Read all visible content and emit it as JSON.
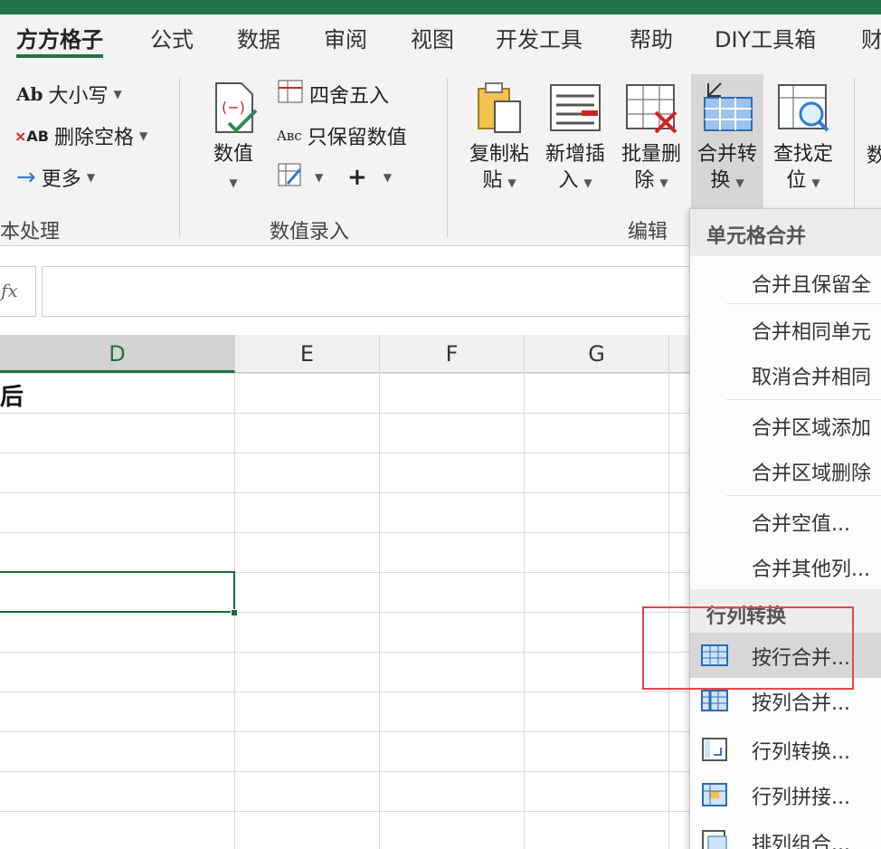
{
  "tabs": [
    "方方格子",
    "公式",
    "数据",
    "审阅",
    "视图",
    "开发工具",
    "帮助",
    "DIY工具箱",
    "财"
  ],
  "ribbon": {
    "text_group": {
      "label": "本处理",
      "case_btn": "大小写",
      "remove_space_btn": "删除空格",
      "more_btn": "更多"
    },
    "value_group": {
      "label": "数值录入",
      "number_btn": "数值",
      "round_btn": "四舍五入",
      "keep_value_btn": "只保留数值",
      "plus_symbol": "+"
    },
    "edit_group": {
      "label": "编辑",
      "copy_paste": [
        "复制粘",
        "贴"
      ],
      "insert": [
        "新增插",
        "入"
      ],
      "batch_delete": [
        "批量删",
        "除"
      ],
      "merge_convert": [
        "合并转",
        "换"
      ],
      "find_locate": [
        "查找定",
        "位"
      ],
      "cut_text": "数"
    }
  },
  "formula_bar": {
    "fx_label": "fx"
  },
  "columns": [
    "D",
    "E",
    "F",
    "G"
  ],
  "cells": {
    "d1": "后"
  },
  "menu": {
    "section1": "单元格合并",
    "items1": [
      "合并且保留全",
      "合并相同单元",
      "取消合并相同",
      "合并区域添加",
      "合并区域删除",
      "合并空值...",
      "合并其他列..."
    ],
    "section2": "行列转换",
    "items2": [
      "按行合并...",
      "按列合并...",
      "行列转换...",
      "行列拼接...",
      "排列组合..."
    ]
  },
  "colors": {
    "accent": "#217346",
    "highlight": "#e04848"
  }
}
